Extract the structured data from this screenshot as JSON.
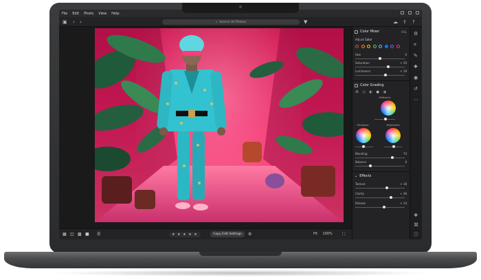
{
  "menu": {
    "items": [
      "File",
      "Edit",
      "Photo",
      "View",
      "Help"
    ]
  },
  "toolbar": {
    "search_placeholder": "Search All Photos"
  },
  "edit_panel": {
    "color_mixer": {
      "title": "Color Mixer",
      "badge": "HSL",
      "adjust_label": "Adjust",
      "adjust_value": "Color",
      "swatch_colors": [
        "#ff3b30",
        "#ff9500",
        "#ffcc00",
        "#4cd964",
        "#5ac8fa",
        "#007aff",
        "#8e5cf0",
        "#ff2d92"
      ],
      "sliders": [
        {
          "label": "Hue",
          "value": "0"
        },
        {
          "label": "Saturation",
          "value": "+ 29"
        },
        {
          "label": "Luminance",
          "value": "+ 19"
        }
      ]
    },
    "color_grading": {
      "title": "Color Grading",
      "midtones_label": "Midtones",
      "shadows_label": "Shadows",
      "highlights_label": "Highlights",
      "blending_label": "Blending",
      "blending_value": "74",
      "balance_label": "Balance",
      "balance_value": "0"
    },
    "effects": {
      "title": "Effects",
      "sliders": [
        {
          "label": "Texture",
          "value": "+ 18"
        },
        {
          "label": "Clarity",
          "value": "+ 36"
        },
        {
          "label": "Dehaze",
          "value": "+ 14"
        }
      ]
    }
  },
  "filmstrip": {
    "copy_label": "Copy Edit Settings",
    "stars": "★ ★ ★ ★ ★",
    "zoom_label": "Fit",
    "zoom_value": "100%"
  },
  "colors": {
    "accent": "#ff2d92",
    "panel_bg": "#232325",
    "photo_wall": "#e2195e",
    "suit": "#2bb8c4"
  },
  "icons": [
    "cloud-icon",
    "sidebar-icon",
    "back-arrow-icon",
    "forward-arrow-icon",
    "search-icon",
    "filter-icon",
    "share-icon",
    "help-icon",
    "grid-icon",
    "single-view-icon",
    "compare-icon",
    "sort-icon",
    "star-icon",
    "crop-icon",
    "brush-icon",
    "healing-icon",
    "sliders-icon",
    "presets-icon",
    "info-icon"
  ]
}
